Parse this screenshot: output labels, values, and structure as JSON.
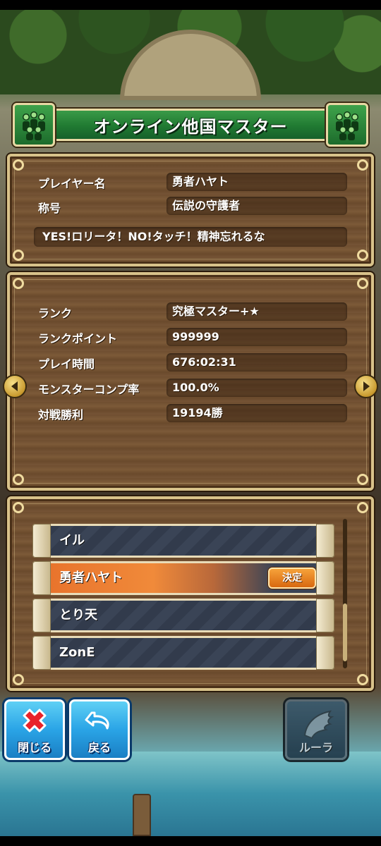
{
  "title": "オンライン他国マスター",
  "profile": {
    "player_name_label": "プレイヤー名",
    "player_name": "勇者ハヤト",
    "title_label": "称号",
    "title_value": "伝説の守護者",
    "motto": "YES!ロリータ！NO!タッチ！精神忘れるな"
  },
  "stats": [
    {
      "label": "ランク",
      "value": "究極マスター+★"
    },
    {
      "label": "ランクポイント",
      "value": "999999"
    },
    {
      "label": "プレイ時間",
      "value": "676:02:31"
    },
    {
      "label": "モンスターコンプ率",
      "value": "100.0%"
    },
    {
      "label": "対戦勝利",
      "value": "19194勝"
    }
  ],
  "list": {
    "items": [
      "イル",
      "勇者ハヤト",
      "とり天",
      "ZonE"
    ],
    "selected_index": 1,
    "decide_label": "決定"
  },
  "buttons": {
    "close_label": "閉じる",
    "back_label": "戻る",
    "ruler_label": "ルーラ"
  },
  "colors": {
    "title_green": "#207a32",
    "wood": "#6f4e30",
    "selected_orange": "#e7702a",
    "button_blue": "#2aa4e6"
  }
}
